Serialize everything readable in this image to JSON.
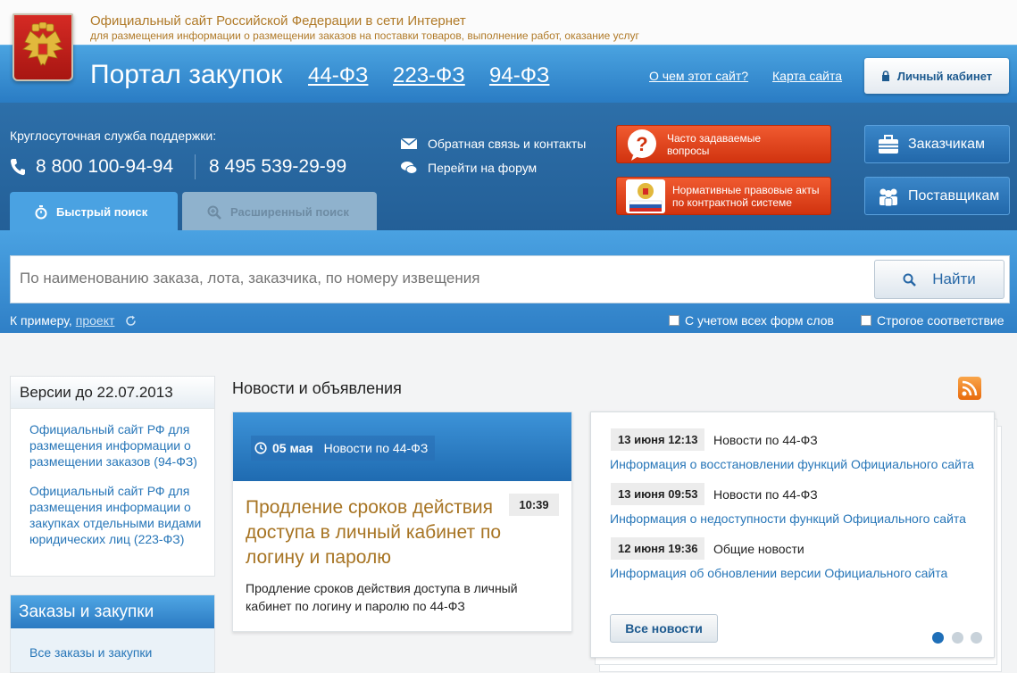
{
  "header": {
    "site_title": "Официальный сайт Российской Федерации в сети Интернет",
    "site_subtitle": "для размещения информации о размещении заказов на поставки товаров, выполнение работ, оказание услуг",
    "portal_title": "Портал закупок",
    "laws": [
      "44-ФЗ",
      "223-ФЗ",
      "94-ФЗ"
    ],
    "about_link": "О чем этот сайт?",
    "sitemap_link": "Карта сайта",
    "cabinet_button": "Личный кабинет"
  },
  "support": {
    "label": "Круглосуточная служба поддержки:",
    "phone1": "8 800 100-94-94",
    "phone2": "8 495 539-29-99",
    "feedback_link": "Обратная связь и контакты",
    "forum_link": "Перейти на форум",
    "faq_button": "Часто задаваемые вопросы",
    "legal_button": "Нормативные правовые акты по контрактной системе",
    "customers_button": "Заказчикам",
    "suppliers_button": "Поставщикам"
  },
  "search": {
    "tab_quick": "Быстрый поиск",
    "tab_advanced": "Расширенный поиск",
    "placeholder": "По наименованию заказа, лота, заказчика, по номеру извещения",
    "find_button": "Найти",
    "example_label": "К примеру,",
    "example_link": "проект",
    "opt_all_forms": "С учетом всех форм слов",
    "opt_strict": "Строгое соответствие"
  },
  "sidebar": {
    "versions_title": "Версии до 22.07.2013",
    "versions_links": [
      "Официальный сайт РФ для размещения информации о размещении заказов (94-ФЗ)",
      "Официальный сайт РФ для размещения информации о закупках отдельными видами юридических лиц (223-ФЗ)"
    ],
    "orders_title": "Заказы и закупки",
    "orders_link": "Все заказы и закупки"
  },
  "news": {
    "title": "Новости и объявления",
    "featured": {
      "date": "05 мая",
      "category": "Новости по 44-ФЗ",
      "headline": "Продление сроков действия доступа в личный кабинет по логину и паролю",
      "time": "10:39",
      "text": "Продление сроков действия доступа в личный кабинет по логину и паролю по 44-ФЗ"
    },
    "items": [
      {
        "date": "13 июня 12:13",
        "category": "Новости по 44-ФЗ",
        "link": "Информация о восстановлении функций Официального сайта"
      },
      {
        "date": "13 июня 09:53",
        "category": "Новости по 44-ФЗ",
        "link": "Информация о недоступности функций Официального сайта"
      },
      {
        "date": "12 июня 19:36",
        "category": "Общие новости",
        "link": "Информация об обновлении версии Официального сайта"
      }
    ],
    "all_news_button": "Все новости"
  },
  "colors": {
    "primary_blue": "#2a7cc4",
    "accent_red": "#e0421a",
    "link": "#2776b8",
    "gold": "#b07a28"
  }
}
